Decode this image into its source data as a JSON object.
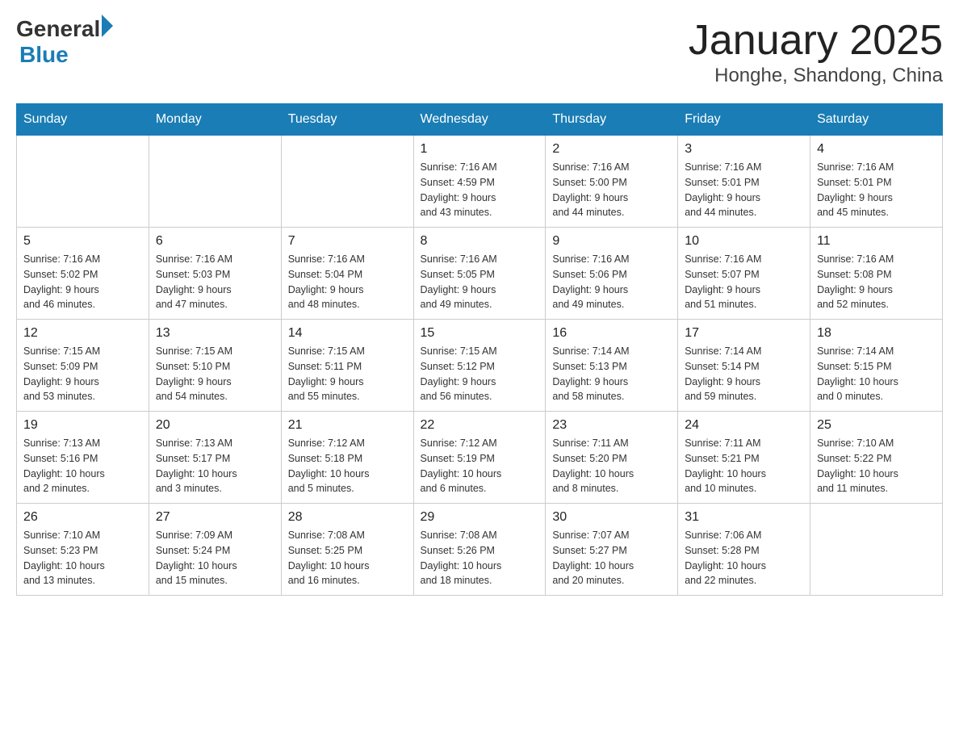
{
  "header": {
    "logo_general": "General",
    "logo_blue": "Blue",
    "title": "January 2025",
    "subtitle": "Honghe, Shandong, China"
  },
  "days_of_week": [
    "Sunday",
    "Monday",
    "Tuesday",
    "Wednesday",
    "Thursday",
    "Friday",
    "Saturday"
  ],
  "weeks": [
    [
      {
        "day": "",
        "info": ""
      },
      {
        "day": "",
        "info": ""
      },
      {
        "day": "",
        "info": ""
      },
      {
        "day": "1",
        "info": "Sunrise: 7:16 AM\nSunset: 4:59 PM\nDaylight: 9 hours\nand 43 minutes."
      },
      {
        "day": "2",
        "info": "Sunrise: 7:16 AM\nSunset: 5:00 PM\nDaylight: 9 hours\nand 44 minutes."
      },
      {
        "day": "3",
        "info": "Sunrise: 7:16 AM\nSunset: 5:01 PM\nDaylight: 9 hours\nand 44 minutes."
      },
      {
        "day": "4",
        "info": "Sunrise: 7:16 AM\nSunset: 5:01 PM\nDaylight: 9 hours\nand 45 minutes."
      }
    ],
    [
      {
        "day": "5",
        "info": "Sunrise: 7:16 AM\nSunset: 5:02 PM\nDaylight: 9 hours\nand 46 minutes."
      },
      {
        "day": "6",
        "info": "Sunrise: 7:16 AM\nSunset: 5:03 PM\nDaylight: 9 hours\nand 47 minutes."
      },
      {
        "day": "7",
        "info": "Sunrise: 7:16 AM\nSunset: 5:04 PM\nDaylight: 9 hours\nand 48 minutes."
      },
      {
        "day": "8",
        "info": "Sunrise: 7:16 AM\nSunset: 5:05 PM\nDaylight: 9 hours\nand 49 minutes."
      },
      {
        "day": "9",
        "info": "Sunrise: 7:16 AM\nSunset: 5:06 PM\nDaylight: 9 hours\nand 49 minutes."
      },
      {
        "day": "10",
        "info": "Sunrise: 7:16 AM\nSunset: 5:07 PM\nDaylight: 9 hours\nand 51 minutes."
      },
      {
        "day": "11",
        "info": "Sunrise: 7:16 AM\nSunset: 5:08 PM\nDaylight: 9 hours\nand 52 minutes."
      }
    ],
    [
      {
        "day": "12",
        "info": "Sunrise: 7:15 AM\nSunset: 5:09 PM\nDaylight: 9 hours\nand 53 minutes."
      },
      {
        "day": "13",
        "info": "Sunrise: 7:15 AM\nSunset: 5:10 PM\nDaylight: 9 hours\nand 54 minutes."
      },
      {
        "day": "14",
        "info": "Sunrise: 7:15 AM\nSunset: 5:11 PM\nDaylight: 9 hours\nand 55 minutes."
      },
      {
        "day": "15",
        "info": "Sunrise: 7:15 AM\nSunset: 5:12 PM\nDaylight: 9 hours\nand 56 minutes."
      },
      {
        "day": "16",
        "info": "Sunrise: 7:14 AM\nSunset: 5:13 PM\nDaylight: 9 hours\nand 58 minutes."
      },
      {
        "day": "17",
        "info": "Sunrise: 7:14 AM\nSunset: 5:14 PM\nDaylight: 9 hours\nand 59 minutes."
      },
      {
        "day": "18",
        "info": "Sunrise: 7:14 AM\nSunset: 5:15 PM\nDaylight: 10 hours\nand 0 minutes."
      }
    ],
    [
      {
        "day": "19",
        "info": "Sunrise: 7:13 AM\nSunset: 5:16 PM\nDaylight: 10 hours\nand 2 minutes."
      },
      {
        "day": "20",
        "info": "Sunrise: 7:13 AM\nSunset: 5:17 PM\nDaylight: 10 hours\nand 3 minutes."
      },
      {
        "day": "21",
        "info": "Sunrise: 7:12 AM\nSunset: 5:18 PM\nDaylight: 10 hours\nand 5 minutes."
      },
      {
        "day": "22",
        "info": "Sunrise: 7:12 AM\nSunset: 5:19 PM\nDaylight: 10 hours\nand 6 minutes."
      },
      {
        "day": "23",
        "info": "Sunrise: 7:11 AM\nSunset: 5:20 PM\nDaylight: 10 hours\nand 8 minutes."
      },
      {
        "day": "24",
        "info": "Sunrise: 7:11 AM\nSunset: 5:21 PM\nDaylight: 10 hours\nand 10 minutes."
      },
      {
        "day": "25",
        "info": "Sunrise: 7:10 AM\nSunset: 5:22 PM\nDaylight: 10 hours\nand 11 minutes."
      }
    ],
    [
      {
        "day": "26",
        "info": "Sunrise: 7:10 AM\nSunset: 5:23 PM\nDaylight: 10 hours\nand 13 minutes."
      },
      {
        "day": "27",
        "info": "Sunrise: 7:09 AM\nSunset: 5:24 PM\nDaylight: 10 hours\nand 15 minutes."
      },
      {
        "day": "28",
        "info": "Sunrise: 7:08 AM\nSunset: 5:25 PM\nDaylight: 10 hours\nand 16 minutes."
      },
      {
        "day": "29",
        "info": "Sunrise: 7:08 AM\nSunset: 5:26 PM\nDaylight: 10 hours\nand 18 minutes."
      },
      {
        "day": "30",
        "info": "Sunrise: 7:07 AM\nSunset: 5:27 PM\nDaylight: 10 hours\nand 20 minutes."
      },
      {
        "day": "31",
        "info": "Sunrise: 7:06 AM\nSunset: 5:28 PM\nDaylight: 10 hours\nand 22 minutes."
      },
      {
        "day": "",
        "info": ""
      }
    ]
  ]
}
